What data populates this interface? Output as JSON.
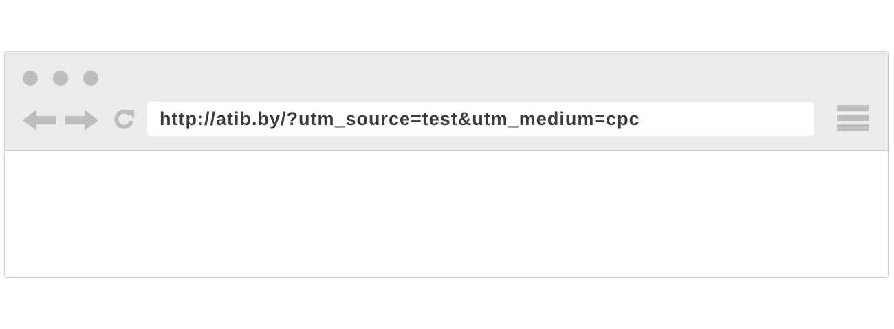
{
  "browser": {
    "window_controls": [
      "window-dot",
      "window-dot",
      "window-dot"
    ],
    "toolbar": {
      "back_icon": "arrow-left-icon",
      "forward_icon": "arrow-right-icon",
      "reload_icon": "reload-icon",
      "menu_icon": "hamburger-menu-icon"
    },
    "address_bar": {
      "url": "http://atib.by/?utm_source=test&utm_medium=cpc"
    },
    "colors": {
      "chrome_background": "#ebebeb",
      "icon_gray": "#bdbdbd",
      "url_text": "#3a3a3a"
    }
  }
}
